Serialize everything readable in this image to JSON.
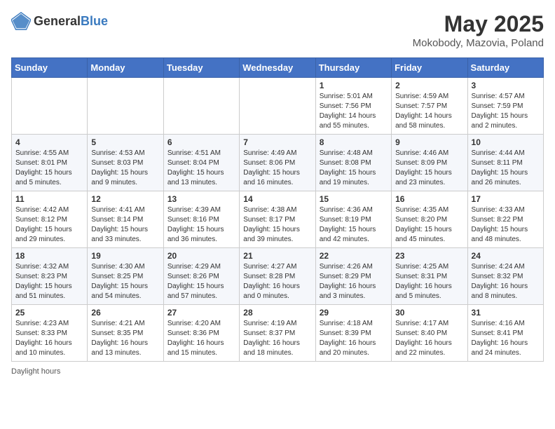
{
  "header": {
    "logo_general": "General",
    "logo_blue": "Blue",
    "month_title": "May 2025",
    "location": "Mokobody, Mazovia, Poland"
  },
  "footer": {
    "daylight_label": "Daylight hours"
  },
  "weekdays": [
    "Sunday",
    "Monday",
    "Tuesday",
    "Wednesday",
    "Thursday",
    "Friday",
    "Saturday"
  ],
  "weeks": [
    [
      {
        "day": "",
        "sunrise": "",
        "sunset": "",
        "daylight": ""
      },
      {
        "day": "",
        "sunrise": "",
        "sunset": "",
        "daylight": ""
      },
      {
        "day": "",
        "sunrise": "",
        "sunset": "",
        "daylight": ""
      },
      {
        "day": "",
        "sunrise": "",
        "sunset": "",
        "daylight": ""
      },
      {
        "day": "1",
        "sunrise": "Sunrise: 5:01 AM",
        "sunset": "Sunset: 7:56 PM",
        "daylight": "Daylight: 14 hours and 55 minutes."
      },
      {
        "day": "2",
        "sunrise": "Sunrise: 4:59 AM",
        "sunset": "Sunset: 7:57 PM",
        "daylight": "Daylight: 14 hours and 58 minutes."
      },
      {
        "day": "3",
        "sunrise": "Sunrise: 4:57 AM",
        "sunset": "Sunset: 7:59 PM",
        "daylight": "Daylight: 15 hours and 2 minutes."
      }
    ],
    [
      {
        "day": "4",
        "sunrise": "Sunrise: 4:55 AM",
        "sunset": "Sunset: 8:01 PM",
        "daylight": "Daylight: 15 hours and 5 minutes."
      },
      {
        "day": "5",
        "sunrise": "Sunrise: 4:53 AM",
        "sunset": "Sunset: 8:03 PM",
        "daylight": "Daylight: 15 hours and 9 minutes."
      },
      {
        "day": "6",
        "sunrise": "Sunrise: 4:51 AM",
        "sunset": "Sunset: 8:04 PM",
        "daylight": "Daylight: 15 hours and 13 minutes."
      },
      {
        "day": "7",
        "sunrise": "Sunrise: 4:49 AM",
        "sunset": "Sunset: 8:06 PM",
        "daylight": "Daylight: 15 hours and 16 minutes."
      },
      {
        "day": "8",
        "sunrise": "Sunrise: 4:48 AM",
        "sunset": "Sunset: 8:08 PM",
        "daylight": "Daylight: 15 hours and 19 minutes."
      },
      {
        "day": "9",
        "sunrise": "Sunrise: 4:46 AM",
        "sunset": "Sunset: 8:09 PM",
        "daylight": "Daylight: 15 hours and 23 minutes."
      },
      {
        "day": "10",
        "sunrise": "Sunrise: 4:44 AM",
        "sunset": "Sunset: 8:11 PM",
        "daylight": "Daylight: 15 hours and 26 minutes."
      }
    ],
    [
      {
        "day": "11",
        "sunrise": "Sunrise: 4:42 AM",
        "sunset": "Sunset: 8:12 PM",
        "daylight": "Daylight: 15 hours and 29 minutes."
      },
      {
        "day": "12",
        "sunrise": "Sunrise: 4:41 AM",
        "sunset": "Sunset: 8:14 PM",
        "daylight": "Daylight: 15 hours and 33 minutes."
      },
      {
        "day": "13",
        "sunrise": "Sunrise: 4:39 AM",
        "sunset": "Sunset: 8:16 PM",
        "daylight": "Daylight: 15 hours and 36 minutes."
      },
      {
        "day": "14",
        "sunrise": "Sunrise: 4:38 AM",
        "sunset": "Sunset: 8:17 PM",
        "daylight": "Daylight: 15 hours and 39 minutes."
      },
      {
        "day": "15",
        "sunrise": "Sunrise: 4:36 AM",
        "sunset": "Sunset: 8:19 PM",
        "daylight": "Daylight: 15 hours and 42 minutes."
      },
      {
        "day": "16",
        "sunrise": "Sunrise: 4:35 AM",
        "sunset": "Sunset: 8:20 PM",
        "daylight": "Daylight: 15 hours and 45 minutes."
      },
      {
        "day": "17",
        "sunrise": "Sunrise: 4:33 AM",
        "sunset": "Sunset: 8:22 PM",
        "daylight": "Daylight: 15 hours and 48 minutes."
      }
    ],
    [
      {
        "day": "18",
        "sunrise": "Sunrise: 4:32 AM",
        "sunset": "Sunset: 8:23 PM",
        "daylight": "Daylight: 15 hours and 51 minutes."
      },
      {
        "day": "19",
        "sunrise": "Sunrise: 4:30 AM",
        "sunset": "Sunset: 8:25 PM",
        "daylight": "Daylight: 15 hours and 54 minutes."
      },
      {
        "day": "20",
        "sunrise": "Sunrise: 4:29 AM",
        "sunset": "Sunset: 8:26 PM",
        "daylight": "Daylight: 15 hours and 57 minutes."
      },
      {
        "day": "21",
        "sunrise": "Sunrise: 4:27 AM",
        "sunset": "Sunset: 8:28 PM",
        "daylight": "Daylight: 16 hours and 0 minutes."
      },
      {
        "day": "22",
        "sunrise": "Sunrise: 4:26 AM",
        "sunset": "Sunset: 8:29 PM",
        "daylight": "Daylight: 16 hours and 3 minutes."
      },
      {
        "day": "23",
        "sunrise": "Sunrise: 4:25 AM",
        "sunset": "Sunset: 8:31 PM",
        "daylight": "Daylight: 16 hours and 5 minutes."
      },
      {
        "day": "24",
        "sunrise": "Sunrise: 4:24 AM",
        "sunset": "Sunset: 8:32 PM",
        "daylight": "Daylight: 16 hours and 8 minutes."
      }
    ],
    [
      {
        "day": "25",
        "sunrise": "Sunrise: 4:23 AM",
        "sunset": "Sunset: 8:33 PM",
        "daylight": "Daylight: 16 hours and 10 minutes."
      },
      {
        "day": "26",
        "sunrise": "Sunrise: 4:21 AM",
        "sunset": "Sunset: 8:35 PM",
        "daylight": "Daylight: 16 hours and 13 minutes."
      },
      {
        "day": "27",
        "sunrise": "Sunrise: 4:20 AM",
        "sunset": "Sunset: 8:36 PM",
        "daylight": "Daylight: 16 hours and 15 minutes."
      },
      {
        "day": "28",
        "sunrise": "Sunrise: 4:19 AM",
        "sunset": "Sunset: 8:37 PM",
        "daylight": "Daylight: 16 hours and 18 minutes."
      },
      {
        "day": "29",
        "sunrise": "Sunrise: 4:18 AM",
        "sunset": "Sunset: 8:39 PM",
        "daylight": "Daylight: 16 hours and 20 minutes."
      },
      {
        "day": "30",
        "sunrise": "Sunrise: 4:17 AM",
        "sunset": "Sunset: 8:40 PM",
        "daylight": "Daylight: 16 hours and 22 minutes."
      },
      {
        "day": "31",
        "sunrise": "Sunrise: 4:16 AM",
        "sunset": "Sunset: 8:41 PM",
        "daylight": "Daylight: 16 hours and 24 minutes."
      }
    ]
  ]
}
